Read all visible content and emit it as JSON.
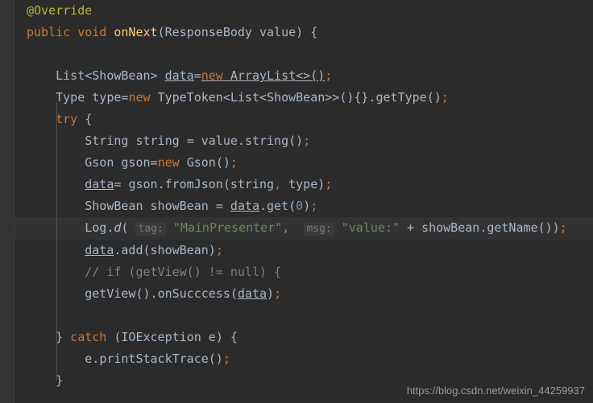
{
  "code": {
    "annotation": "@Override",
    "kw_public": "public",
    "kw_void": "void",
    "method_onNext": "onNext",
    "type_ResponseBody": "ResponseBody",
    "param_value": "value",
    "type_List": "List",
    "type_ShowBean": "ShowBean",
    "var_data": "data",
    "kw_new": "new",
    "type_ArrayList": "ArrayList",
    "type_Type": "Type",
    "var_type": "type",
    "type_TypeToken": "TypeToken",
    "method_getType": "getType",
    "kw_try": "try",
    "type_String": "String",
    "var_string": "string",
    "method_string": "string",
    "type_Gson": "Gson",
    "var_gson": "gson",
    "method_fromJson": "fromJson",
    "var_showBean": "showBean",
    "method_get": "get",
    "num_zero": "0",
    "type_Log": "Log",
    "method_d": "d",
    "label_tag": "tag:",
    "str_mainPresenter": "\"MainPresenter\"",
    "label_msg": "msg:",
    "str_value": "\"value:\"",
    "method_getName": "getName",
    "method_add": "add",
    "comment_if": "// if (getView() != null) {",
    "method_getView": "getView",
    "method_onSuccess": "onSucccess",
    "kw_catch": "catch",
    "type_IOException": "IOException",
    "var_e": "e",
    "method_printStackTrace": "printStackTrace"
  },
  "watermark": "https://blog.csdn.net/weixin_44259937"
}
